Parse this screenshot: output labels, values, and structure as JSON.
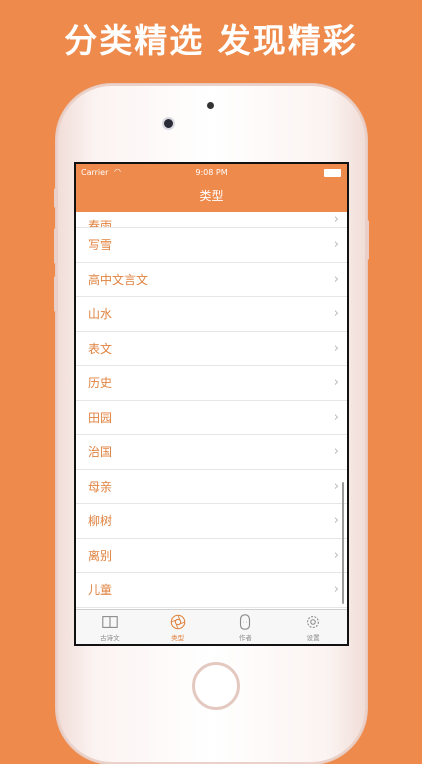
{
  "headline": "分类精选 发现精彩",
  "status_bar": {
    "carrier": "Carrier",
    "time": "9:08 PM"
  },
  "nav": {
    "title": "类型"
  },
  "list": {
    "items": [
      {
        "label": "春雨"
      },
      {
        "label": "写雪"
      },
      {
        "label": "高中文言文"
      },
      {
        "label": "山水"
      },
      {
        "label": "表文"
      },
      {
        "label": "历史"
      },
      {
        "label": "田园"
      },
      {
        "label": "治国"
      },
      {
        "label": "母亲"
      },
      {
        "label": "柳树"
      },
      {
        "label": "离别"
      },
      {
        "label": "儿童"
      }
    ]
  },
  "tabbar": {
    "tabs": [
      {
        "label": "古诗文",
        "icon": "book-icon",
        "active": false
      },
      {
        "label": "类型",
        "icon": "aperture-icon",
        "active": true
      },
      {
        "label": "作者",
        "icon": "head-icon",
        "active": false
      },
      {
        "label": "设置",
        "icon": "gear-icon",
        "active": false
      }
    ]
  },
  "colors": {
    "accent": "#EE8A4B",
    "text_accent": "#E0823F"
  }
}
